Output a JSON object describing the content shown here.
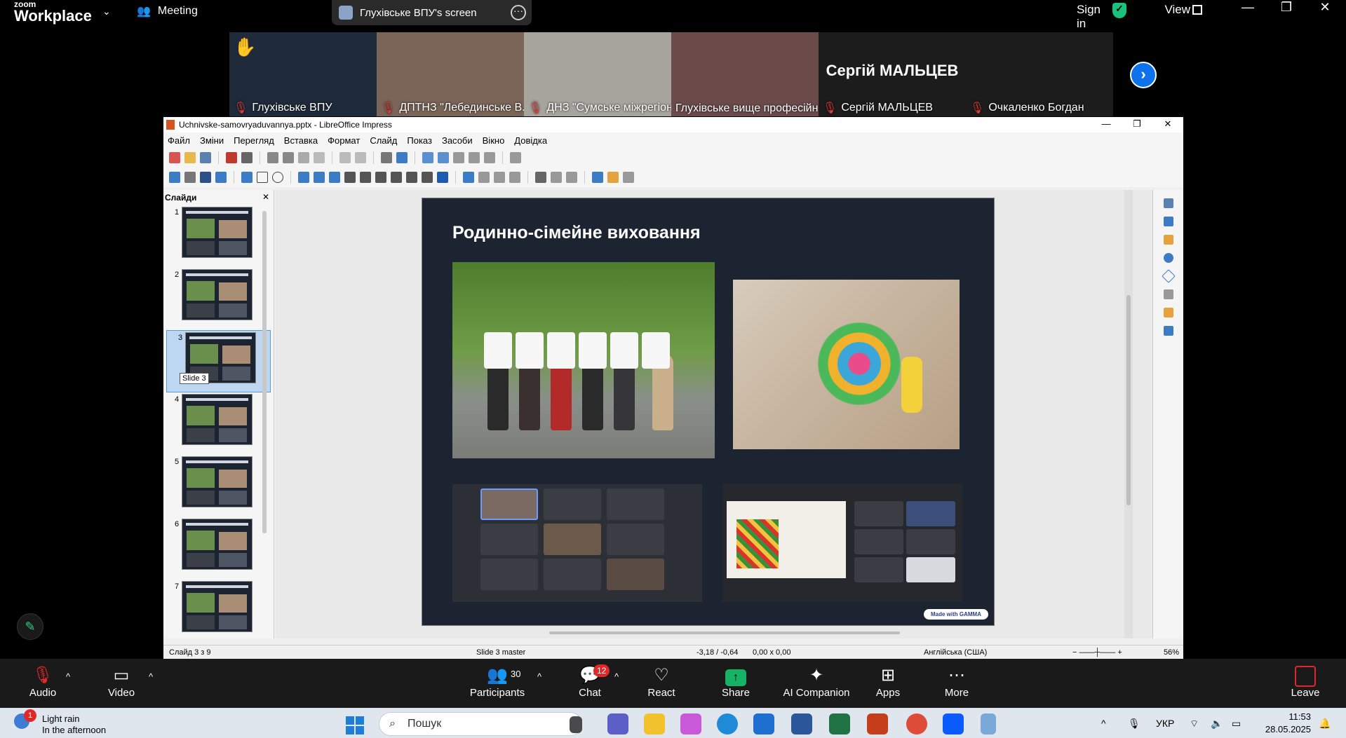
{
  "zoom_top": {
    "logo_small": "zoom",
    "logo_big": "Workplace",
    "meeting_label": "Meeting",
    "screen_share_label": "Глухівське ВПУ's screen",
    "sign_in": "Sign in",
    "view_label": "View"
  },
  "participants_strip": [
    {
      "name": "Глухівське ВПУ",
      "hand": "✋",
      "muted": true,
      "color": "#1f2a3a"
    },
    {
      "name": "ДПТНЗ \"Лебединське В...",
      "muted": true,
      "color": "#7a6558"
    },
    {
      "name": "ДНЗ \"Сумське міжрегіон...",
      "muted": true,
      "color": "#a7a39d"
    },
    {
      "name": "Глухівське вище професійн...",
      "muted": false,
      "active": true,
      "color": "#6b4a4a"
    },
    {
      "name": "Сергій МАЛЬЦЕВ",
      "muted": true,
      "big_name": "Сергій МАЛЬЦЕВ",
      "color": "#1c1c1c"
    },
    {
      "name": "Очкаленко Богдан",
      "muted": true,
      "color": "#1c1c1c"
    }
  ],
  "libreoffice": {
    "title": "Uchnivske-samovryaduvannya.pptx - LibreOffice Impress",
    "menu": [
      "Файл",
      "Зміни",
      "Перегляд",
      "Вставка",
      "Формат",
      "Слайд",
      "Показ",
      "Засоби",
      "Вікно",
      "Довідка"
    ],
    "slides_panel_title": "Слайди",
    "slide_numbers": [
      "1",
      "2",
      "3",
      "4",
      "5",
      "6",
      "7"
    ],
    "tooltip": "Slide 3",
    "slide": {
      "title": "Родинно-сімейне виховання",
      "badge": "Made with GAMMA"
    },
    "status": {
      "slide_of": "Слайд 3 з 9",
      "master": "Slide 3 master",
      "position": "-3,18 / -0,64",
      "size": "0,00 x 0,00",
      "language": "Англійська (США)",
      "zoom": "56%"
    }
  },
  "zoom_bottom": {
    "audio": "Audio",
    "video": "Video",
    "participants": "Participants",
    "participants_count": "30",
    "chat": "Chat",
    "chat_badge": "12",
    "react": "React",
    "share": "Share",
    "ai": "AI Companion",
    "apps": "Apps",
    "more": "More",
    "leave": "Leave"
  },
  "taskbar": {
    "weather_title": "Light rain",
    "weather_sub": "In the afternoon",
    "weather_badge": "1",
    "search_placeholder": "Пошук",
    "lang": "УКР",
    "time": "11:53",
    "date": "28.05.2025"
  }
}
